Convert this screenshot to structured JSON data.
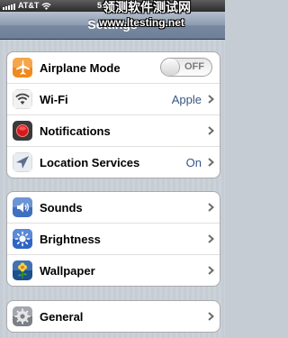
{
  "statusbar": {
    "carrier": "AT&T",
    "time": "5:59 PM"
  },
  "navbar": {
    "title": "Settings"
  },
  "watermark": {
    "line1": "领测软件测试网",
    "line2": "www.ltesting.net"
  },
  "groups": [
    {
      "items": [
        {
          "label": "Airplane Mode",
          "icon": "airplane-icon",
          "toggle": "OFF"
        },
        {
          "label": "Wi-Fi",
          "icon": "wifi-icon",
          "value": "Apple"
        },
        {
          "label": "Notifications",
          "icon": "notifications-icon"
        },
        {
          "label": "Location Services",
          "icon": "location-icon",
          "value": "On"
        }
      ]
    },
    {
      "items": [
        {
          "label": "Sounds",
          "icon": "speaker-icon"
        },
        {
          "label": "Brightness",
          "icon": "sun-icon"
        },
        {
          "label": "Wallpaper",
          "icon": "flower-icon"
        }
      ]
    },
    {
      "items": [
        {
          "label": "General",
          "icon": "gear-icon"
        }
      ]
    }
  ],
  "colors": {
    "navbar": "#7888a0",
    "background": "#c5ccd4",
    "value_text": "#385487"
  }
}
